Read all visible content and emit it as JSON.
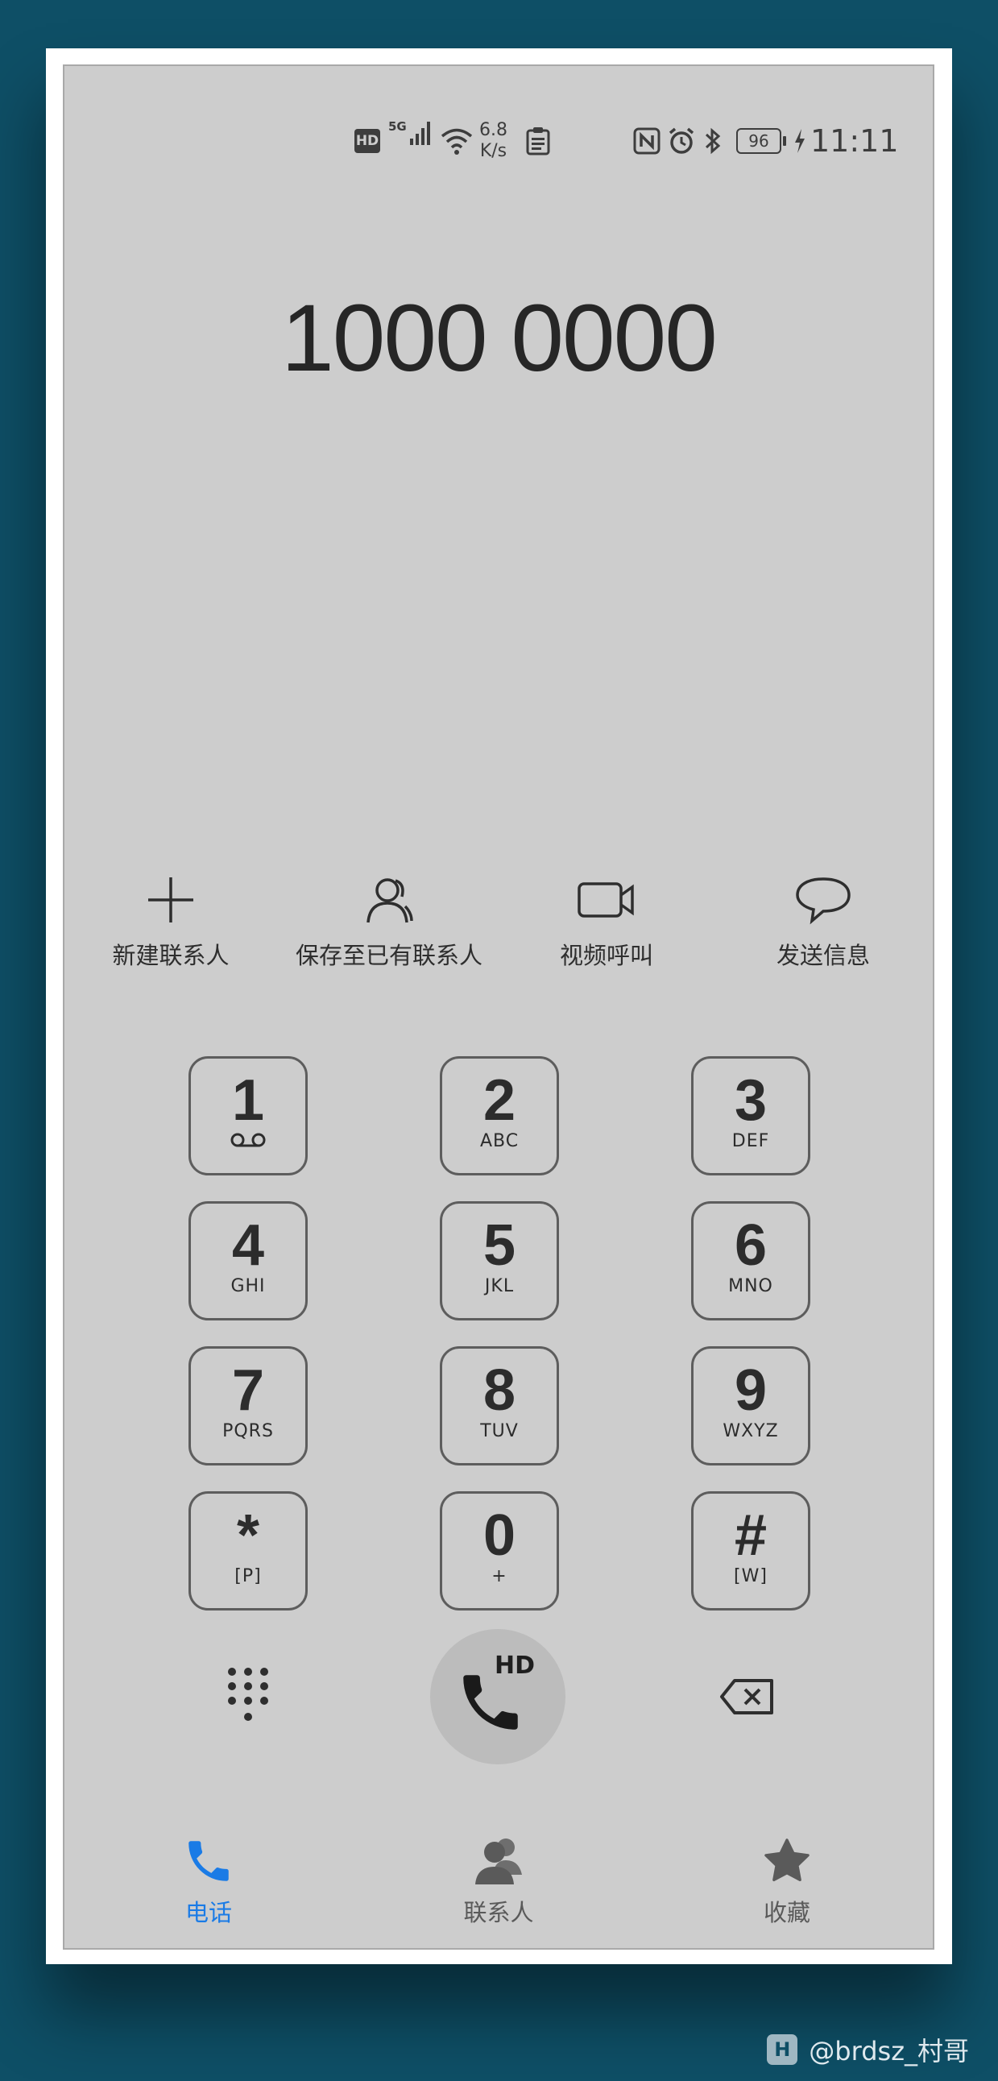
{
  "status_bar": {
    "hd_label": "HD",
    "network_label": "5G",
    "speed_value": "6.8",
    "speed_unit": "K/s",
    "battery_level": "96",
    "time": "11:11"
  },
  "dialed_number": "1000 0000",
  "actions": [
    {
      "label": "新建联系人",
      "icon": "plus-icon"
    },
    {
      "label": "保存至已有联系人",
      "icon": "contact-icon"
    },
    {
      "label": "视频呼叫",
      "icon": "video-icon"
    },
    {
      "label": "发送信息",
      "icon": "message-icon"
    }
  ],
  "keypad": [
    {
      "digit": "1",
      "sub": ""
    },
    {
      "digit": "2",
      "sub": "ABC"
    },
    {
      "digit": "3",
      "sub": "DEF"
    },
    {
      "digit": "4",
      "sub": "GHI"
    },
    {
      "digit": "5",
      "sub": "JKL"
    },
    {
      "digit": "6",
      "sub": "MNO"
    },
    {
      "digit": "7",
      "sub": "PQRS"
    },
    {
      "digit": "8",
      "sub": "TUV"
    },
    {
      "digit": "9",
      "sub": "WXYZ"
    },
    {
      "digit": "*",
      "sub": "[P]"
    },
    {
      "digit": "0",
      "sub": "+"
    },
    {
      "digit": "#",
      "sub": "[W]"
    }
  ],
  "call_button": {
    "hd_label": "HD"
  },
  "tabs": [
    {
      "label": "电话",
      "icon": "phone-icon",
      "active": true
    },
    {
      "label": "联系人",
      "icon": "contacts-icon",
      "active": false
    },
    {
      "label": "收藏",
      "icon": "star-icon",
      "active": false
    }
  ],
  "watermark": {
    "text": "@brdsz_村哥"
  },
  "colors": {
    "active_tab": "#1a7be6",
    "inactive_tab": "#5a5a5a",
    "screen_bg": "#cdcdcd",
    "page_bg": "#0e4f66"
  }
}
